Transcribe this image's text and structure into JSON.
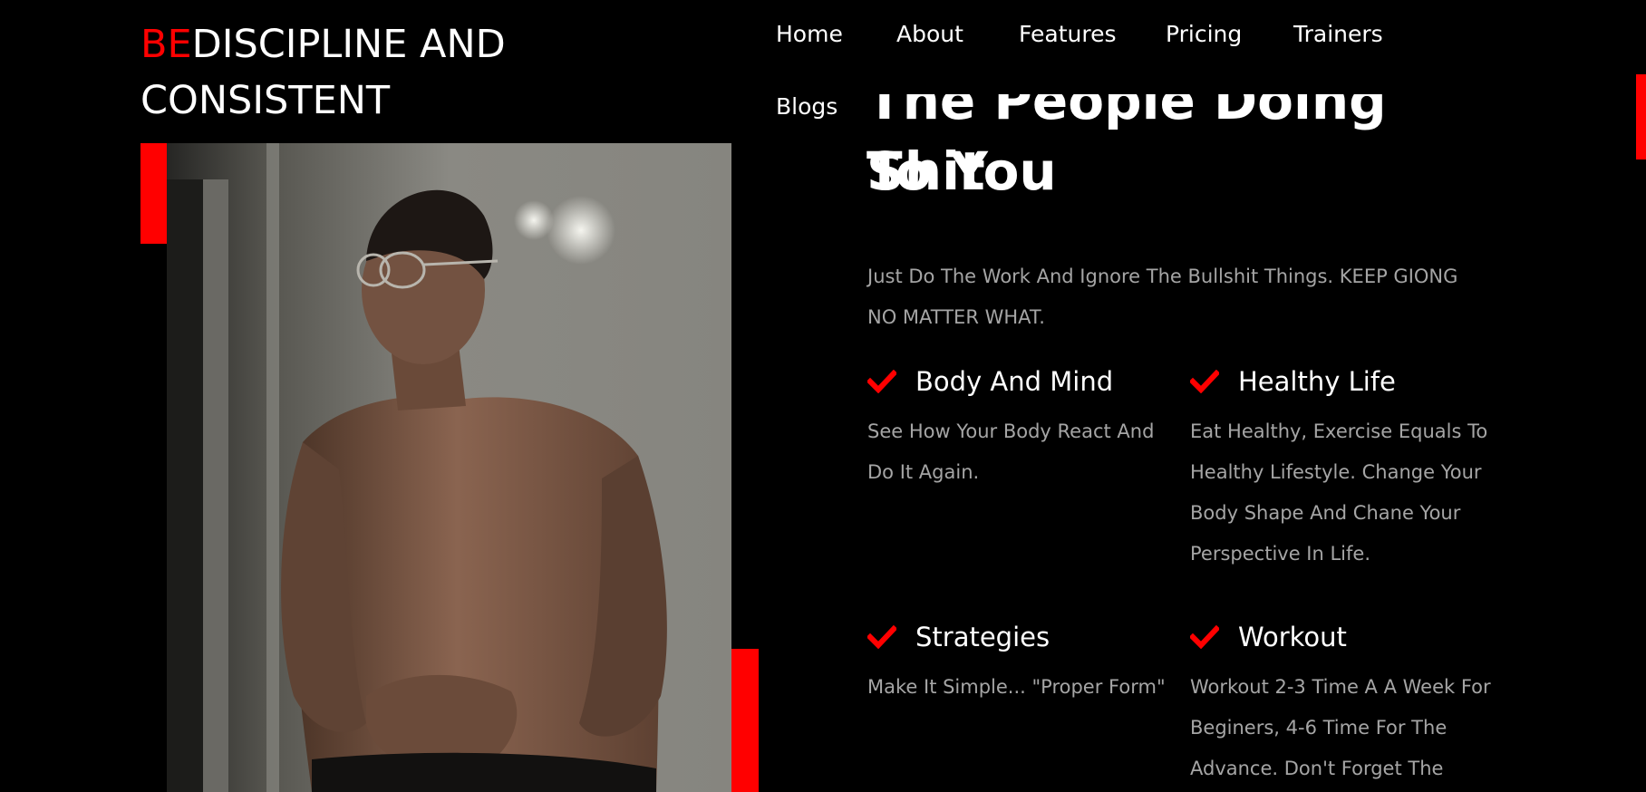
{
  "brand": {
    "accent_text": "BE",
    "text_line1": "DISCIPLINE AND",
    "text_line2": "CONSISTENT",
    "accent_color": "#ff0000"
  },
  "nav": {
    "items": [
      {
        "label": "Home"
      },
      {
        "label": "About"
      },
      {
        "label": "Features"
      },
      {
        "label": "Pricing"
      },
      {
        "label": "Trainers"
      },
      {
        "label": "Blogs"
      }
    ]
  },
  "hero": {
    "photo_description": "person-photo",
    "heading_line1": "The People Doing Shit",
    "heading_line2": "To You",
    "intro": "Just Do The Work And Ignore The Bullshit Things. KEEP GIONG NO MATTER WHAT."
  },
  "features": [
    {
      "icon": "check-icon",
      "title": "Body And Mind",
      "desc": "See How Your Body React And Do It Again."
    },
    {
      "icon": "check-icon",
      "title": "Healthy Life",
      "desc": "Eat Healthy, Exercise Equals To Healthy Lifestyle. Change Your Body Shape And Chane Your Perspective In Life."
    },
    {
      "icon": "check-icon",
      "title": "Strategies",
      "desc": "Make It Simple... \"Proper Form\""
    },
    {
      "icon": "check-icon",
      "title": "Workout",
      "desc": "Workout 2-3 Time A A Week For Beginers, 4-6 Time For The Advance. Don't Forget The"
    }
  ],
  "colors": {
    "background": "#000000",
    "accent": "#ff0000",
    "muted_text": "#a5a5a5"
  }
}
